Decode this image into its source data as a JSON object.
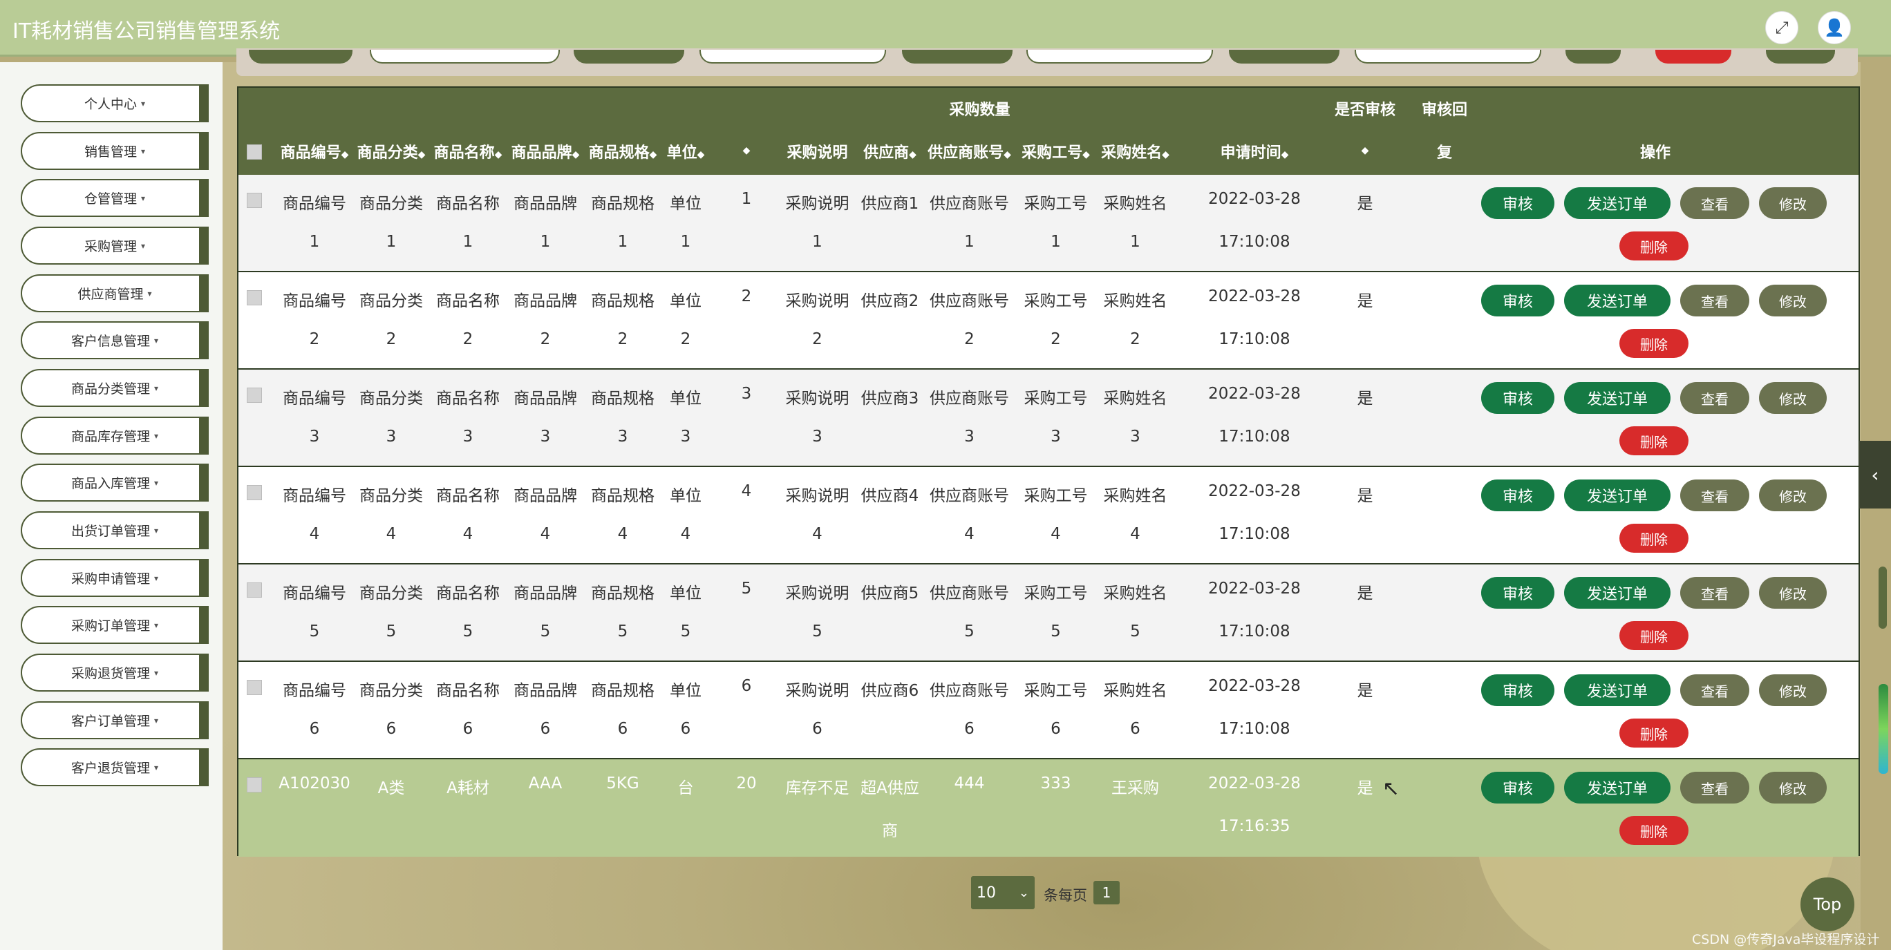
{
  "app_title": "IT耗材销售公司销售管理系统",
  "header": {
    "fullscreen_icon": "expand-icon",
    "user_icon": "user-icon"
  },
  "sidebar": {
    "items": [
      {
        "label": "个人中心"
      },
      {
        "label": "销售管理"
      },
      {
        "label": "仓管管理"
      },
      {
        "label": "采购管理"
      },
      {
        "label": "供应商管理"
      },
      {
        "label": "客户信息管理"
      },
      {
        "label": "商品分类管理"
      },
      {
        "label": "商品库存管理"
      },
      {
        "label": "商品入库管理"
      },
      {
        "label": "出货订单管理"
      },
      {
        "label": "采购申请管理"
      },
      {
        "label": "采购订单管理"
      },
      {
        "label": "采购退货管理"
      },
      {
        "label": "客户订单管理"
      },
      {
        "label": "客户退货管理"
      }
    ],
    "caret": "▾"
  },
  "table": {
    "group_headers": {
      "purchase_qty": "采购数量",
      "audit": "是否审核",
      "audit_reply_1": "审核回",
      "audit_reply_2": "复"
    },
    "columns": {
      "code": "商品编号",
      "category": "商品分类",
      "name": "商品名称",
      "brand": "商品品牌",
      "spec": "商品规格",
      "unit": "单位",
      "desc": "采购说明",
      "supplier": "供应商",
      "supplier_account": "供应商账号",
      "staff_no": "采购工号",
      "staff_name": "采购姓名",
      "apply_time": "申请时间",
      "actions": "操作"
    },
    "sort_glyph": "◆",
    "rows": [
      {
        "code": [
          "商品编号",
          "1"
        ],
        "category": [
          "商品分类",
          "1"
        ],
        "name": [
          "商品名称",
          "1"
        ],
        "brand": [
          "商品品牌",
          "1"
        ],
        "spec": [
          "商品规格",
          "1"
        ],
        "unit": [
          "单位",
          "1"
        ],
        "qty": "1",
        "desc": [
          "采购说明",
          "1"
        ],
        "supplier": [
          "供应商1",
          ""
        ],
        "account": [
          "供应商账号",
          "1"
        ],
        "staff_no": [
          "采购工号",
          "1"
        ],
        "staff_name": [
          "采购姓名",
          "1"
        ],
        "date": "2022-03-28",
        "time": "17:10:08",
        "audited": "是"
      },
      {
        "code": [
          "商品编号",
          "2"
        ],
        "category": [
          "商品分类",
          "2"
        ],
        "name": [
          "商品名称",
          "2"
        ],
        "brand": [
          "商品品牌",
          "2"
        ],
        "spec": [
          "商品规格",
          "2"
        ],
        "unit": [
          "单位",
          "2"
        ],
        "qty": "2",
        "desc": [
          "采购说明",
          "2"
        ],
        "supplier": [
          "供应商2",
          ""
        ],
        "account": [
          "供应商账号",
          "2"
        ],
        "staff_no": [
          "采购工号",
          "2"
        ],
        "staff_name": [
          "采购姓名",
          "2"
        ],
        "date": "2022-03-28",
        "time": "17:10:08",
        "audited": "是"
      },
      {
        "code": [
          "商品编号",
          "3"
        ],
        "category": [
          "商品分类",
          "3"
        ],
        "name": [
          "商品名称",
          "3"
        ],
        "brand": [
          "商品品牌",
          "3"
        ],
        "spec": [
          "商品规格",
          "3"
        ],
        "unit": [
          "单位",
          "3"
        ],
        "qty": "3",
        "desc": [
          "采购说明",
          "3"
        ],
        "supplier": [
          "供应商3",
          ""
        ],
        "account": [
          "供应商账号",
          "3"
        ],
        "staff_no": [
          "采购工号",
          "3"
        ],
        "staff_name": [
          "采购姓名",
          "3"
        ],
        "date": "2022-03-28",
        "time": "17:10:08",
        "audited": "是"
      },
      {
        "code": [
          "商品编号",
          "4"
        ],
        "category": [
          "商品分类",
          "4"
        ],
        "name": [
          "商品名称",
          "4"
        ],
        "brand": [
          "商品品牌",
          "4"
        ],
        "spec": [
          "商品规格",
          "4"
        ],
        "unit": [
          "单位",
          "4"
        ],
        "qty": "4",
        "desc": [
          "采购说明",
          "4"
        ],
        "supplier": [
          "供应商4",
          ""
        ],
        "account": [
          "供应商账号",
          "4"
        ],
        "staff_no": [
          "采购工号",
          "4"
        ],
        "staff_name": [
          "采购姓名",
          "4"
        ],
        "date": "2022-03-28",
        "time": "17:10:08",
        "audited": "是"
      },
      {
        "code": [
          "商品编号",
          "5"
        ],
        "category": [
          "商品分类",
          "5"
        ],
        "name": [
          "商品名称",
          "5"
        ],
        "brand": [
          "商品品牌",
          "5"
        ],
        "spec": [
          "商品规格",
          "5"
        ],
        "unit": [
          "单位",
          "5"
        ],
        "qty": "5",
        "desc": [
          "采购说明",
          "5"
        ],
        "supplier": [
          "供应商5",
          ""
        ],
        "account": [
          "供应商账号",
          "5"
        ],
        "staff_no": [
          "采购工号",
          "5"
        ],
        "staff_name": [
          "采购姓名",
          "5"
        ],
        "date": "2022-03-28",
        "time": "17:10:08",
        "audited": "是"
      },
      {
        "code": [
          "商品编号",
          "6"
        ],
        "category": [
          "商品分类",
          "6"
        ],
        "name": [
          "商品名称",
          "6"
        ],
        "brand": [
          "商品品牌",
          "6"
        ],
        "spec": [
          "商品规格",
          "6"
        ],
        "unit": [
          "单位",
          "6"
        ],
        "qty": "6",
        "desc": [
          "采购说明",
          "6"
        ],
        "supplier": [
          "供应商6",
          ""
        ],
        "account": [
          "供应商账号",
          "6"
        ],
        "staff_no": [
          "采购工号",
          "6"
        ],
        "staff_name": [
          "采购姓名",
          "6"
        ],
        "date": "2022-03-28",
        "time": "17:10:08",
        "audited": "是"
      },
      {
        "code": [
          "A102030",
          ""
        ],
        "category": [
          "A类",
          ""
        ],
        "name": [
          "A耗材",
          ""
        ],
        "brand": [
          "AAA",
          ""
        ],
        "spec": [
          "5KG",
          ""
        ],
        "unit": [
          "台",
          ""
        ],
        "qty": "20",
        "desc": [
          "库存不足",
          ""
        ],
        "supplier": [
          "超A供应",
          "商"
        ],
        "account": [
          "444",
          ""
        ],
        "staff_no": [
          "333",
          ""
        ],
        "staff_name": [
          "王采购",
          ""
        ],
        "date": "2022-03-28",
        "time": "17:16:35",
        "audited": "是"
      }
    ],
    "row_actions": {
      "audit": "审核",
      "send": "发送订单",
      "view": "查看",
      "edit": "修改",
      "delete": "删除"
    }
  },
  "pagination": {
    "page_size": "10",
    "per_page_label": "条每页",
    "current_page": "1"
  },
  "top_button": "Top",
  "watermark": "CSDN @传奇Java毕设程序设计",
  "colors": {
    "header": "#b9cc96",
    "table_header": "#5c6b3f",
    "audit_btn": "#157a44",
    "neutral_btn": "#6b7250",
    "delete_btn": "#d82b2b",
    "highlight_row": "#b7cb93"
  }
}
